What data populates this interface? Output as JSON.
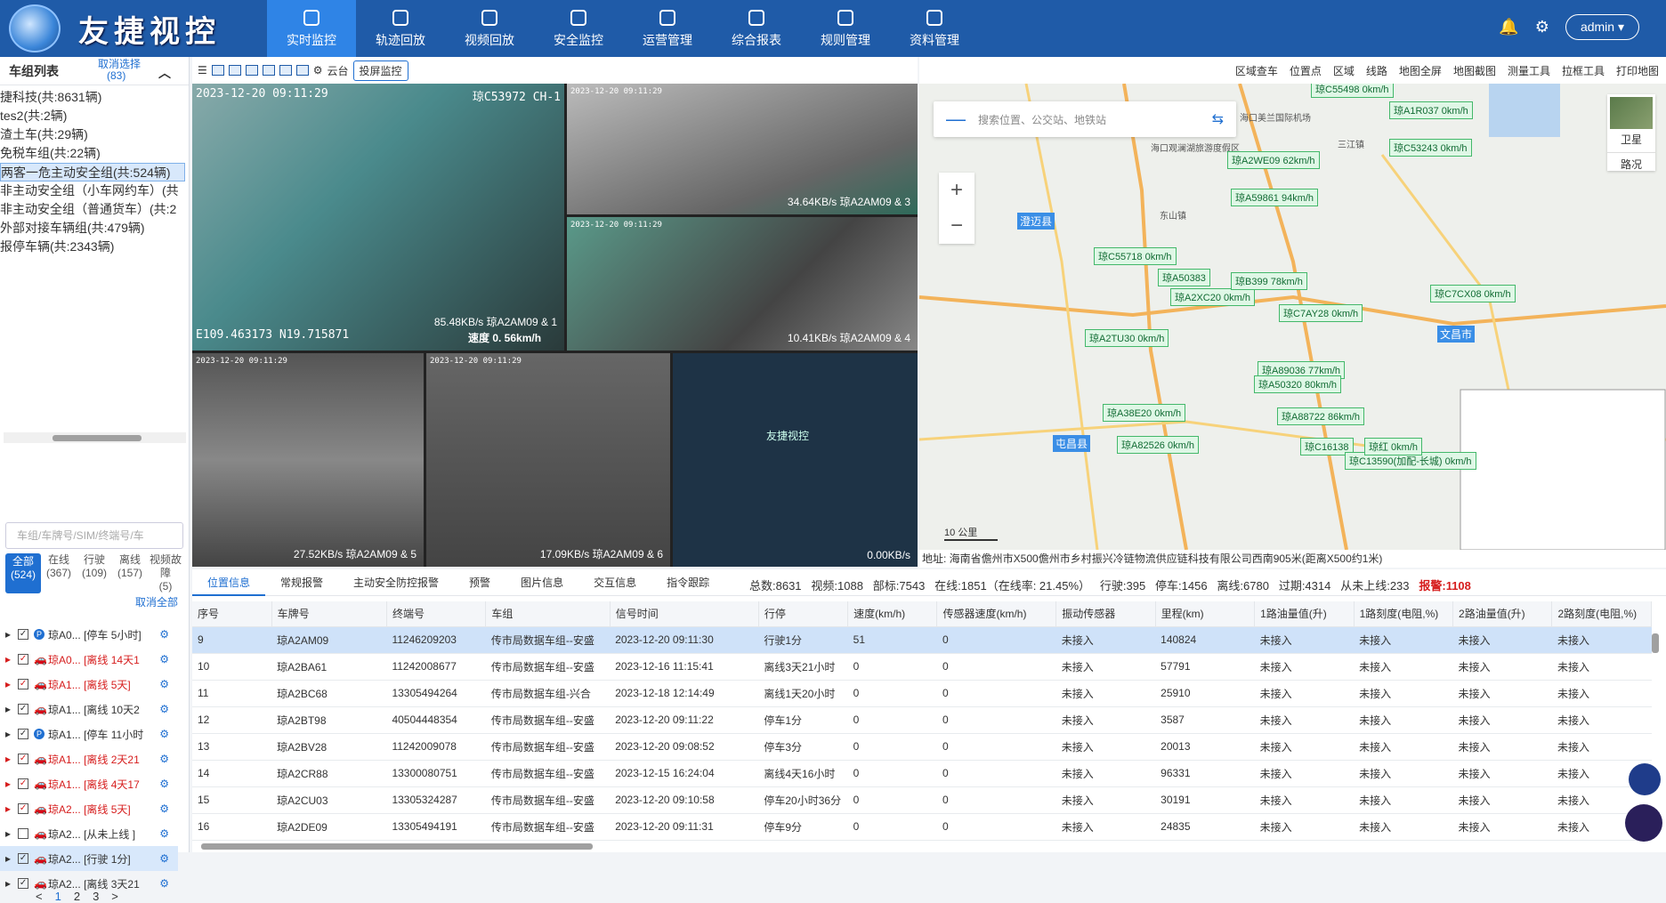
{
  "brand": {
    "name": "友捷视控",
    "video_watermark": "友捷视控"
  },
  "nav": [
    {
      "label": "实时监控",
      "icon": "monitor-icon",
      "active": true
    },
    {
      "label": "轨迹回放",
      "icon": "track-icon"
    },
    {
      "label": "视频回放",
      "icon": "play-icon"
    },
    {
      "label": "安全监控",
      "icon": "shield-icon"
    },
    {
      "label": "运营管理",
      "icon": "ops-icon"
    },
    {
      "label": "综合报表",
      "icon": "report-icon"
    },
    {
      "label": "规则管理",
      "icon": "rules-icon"
    },
    {
      "label": "资料管理",
      "icon": "data-icon"
    }
  ],
  "user": {
    "name": "admin ▾"
  },
  "left": {
    "title": "车组列表",
    "cancel_select": "取消选择",
    "cancel_count": "(83)",
    "groups": [
      "捷科技(共:8631辆)",
      "tes2(共:2辆)",
      "渣土车(共:29辆)",
      "免税车组(共:22辆)",
      "两客一危主动安全组(共:524辆)",
      "非主动安全组（小车网约车）(共",
      "非主动安全组（普通货车）(共:2",
      "外部对接车辆组(共:479辆)",
      "报停车辆(共:2343辆)"
    ],
    "search_placeholder": "车组/车牌号/SIM/终端号/车",
    "filters": [
      {
        "label": "全部",
        "count": "(524)"
      },
      {
        "label": "在线",
        "count": "(367)"
      },
      {
        "label": "行驶",
        "count": "(109)"
      },
      {
        "label": "离线",
        "count": "(157)"
      },
      {
        "label": "视频故障",
        "count": "(5)"
      }
    ],
    "cancel_all": "取消全部",
    "vehicles": [
      {
        "plate": "琼A0...",
        "status": "[停车 5小时]",
        "red": false,
        "p": true
      },
      {
        "plate": "琼A0...",
        "status": "[离线 14天1",
        "red": true,
        "p": false
      },
      {
        "plate": "琼A1...",
        "status": "[离线 5天]",
        "red": true,
        "p": false
      },
      {
        "plate": "琼A1...",
        "status": "[离线 10天2",
        "red": false,
        "p": false
      },
      {
        "plate": "琼A1...",
        "status": "[停车 11小时",
        "red": false,
        "p": true
      },
      {
        "plate": "琼A1...",
        "status": "[离线 2天21",
        "red": true,
        "p": false
      },
      {
        "plate": "琼A1...",
        "status": "[离线 4天17",
        "red": true,
        "p": false
      },
      {
        "plate": "琼A2...",
        "status": "[离线 5天]",
        "red": true,
        "p": false
      },
      {
        "plate": "琼A2...",
        "status": "[从未上线 ]",
        "red": false,
        "p": false
      },
      {
        "plate": "琼A2...",
        "status": "[行驶 1分]",
        "red": false,
        "p": false,
        "hl": true
      },
      {
        "plate": "琼A2...",
        "status": "[离线 3天21",
        "red": false,
        "p": false
      }
    ],
    "pages": [
      "<",
      "1",
      "2",
      "3",
      ">"
    ]
  },
  "videotool": {
    "ptz": "云台",
    "cast": "投屏监控"
  },
  "videos": [
    {
      "ts": "2023-12-20 09:11:29",
      "ch": "琼C53972 CH-1",
      "speed": "85.48KB/s 琼A2AM09 & 1",
      "coord": "E109.463173 N19.715871",
      "spd2": "速度 0. 56km/h"
    },
    {
      "ts": "2023-12-20 09:11:29",
      "speed": "34.64KB/s 琼A2AM09 & 3"
    },
    {
      "ts": "2023-12-20 09:11:29",
      "speed": "10.41KB/s 琼A2AM09 & 4"
    },
    {
      "ts": "2023-12-20 09:11:29",
      "speed": "27.52KB/s 琼A2AM09 & 5"
    },
    {
      "ts": "2023-12-20 09:11:29",
      "speed": "17.09KB/s 琼A2AM09 & 6"
    },
    {
      "ts": "",
      "speed": "0.00KB/s"
    }
  ],
  "maptool": [
    "区域查车",
    "位置点",
    "区域",
    "线路",
    "地图全屏",
    "地图截图",
    "测量工具",
    "拉框工具",
    "打印地图"
  ],
  "map": {
    "search_placeholder": "搜索位置、公交站、地铁站",
    "sat": "卫星",
    "road": "路况",
    "scale": "10 公里",
    "places": [
      "海口美兰国际机场",
      "澄迈县",
      "屯昌县",
      "文昌市",
      "三江镇",
      "东山镇",
      "海口观澜湖旅游度假区"
    ],
    "labels": [
      "琼C55498 0km/h",
      "琼A1R037 0km/h",
      "琼C53243 0km/h",
      "琼A2WE09 62km/h",
      "琼A59861 94km/h",
      "琼C55718 0km/h",
      "琼A50383",
      "琼A2XC20 0km/h",
      "琼B399 78km/h",
      "琼C7AY28 0km/h",
      "琼C7CX08 0km/h",
      "琼A2TU30 0km/h",
      "琼A89036 77km/h",
      "琼A50320 80km/h",
      "琼A38E20 0km/h",
      "琼A88722 86km/h",
      "琼A82526 0km/h",
      "琼C16138",
      "琼C13590(加配-长城) 0km/h",
      "琼红 0km/h"
    ]
  },
  "address": "地址: 海南省儋州市X500儋州市乡村振兴冷链物流供应链科技有限公司西南905米(距离X500约1米)",
  "bottom": {
    "tabs": [
      "位置信息",
      "常规报警",
      "主动安全防控报警",
      "预警",
      "图片信息",
      "交互信息",
      "指令跟踪"
    ],
    "stats": {
      "total": "总数:8631",
      "video": "视频:1088",
      "bd": "部标:7543",
      "online": "在线:1851（在线率:  21.45%）",
      "driving": "行驶:395",
      "parked": "停车:1456",
      "offline": "离线:6780",
      "expired": "过期:4314",
      "never": "从未上线:233",
      "alarm": "报警:1108"
    },
    "columns": [
      "序号",
      "车牌号",
      "终端号",
      "车组",
      "信号时间",
      "行停",
      "速度(km/h)",
      "传感器速度(km/h)",
      "振动传感器",
      "里程(km)",
      "1路油量值(升)",
      "1路刻度(电阻,%)",
      "2路油量值(升)",
      "2路刻度(电阻,%)"
    ],
    "rows": [
      [
        "9",
        "琼A2AM09",
        "11246209203",
        "传市局数据车组--安盛",
        "2023-12-20 09:11:30",
        "行驶1分",
        "51",
        "0",
        "未接入",
        "140824",
        "未接入",
        "未接入",
        "未接入",
        "未接入"
      ],
      [
        "10",
        "琼A2BA61",
        "11242008677",
        "传市局数据车组--安盛",
        "2023-12-16 11:15:41",
        "离线3天21小时",
        "0",
        "0",
        "未接入",
        "57791",
        "未接入",
        "未接入",
        "未接入",
        "未接入"
      ],
      [
        "11",
        "琼A2BC68",
        "13305494264",
        "传市局数据车组-兴合",
        "2023-12-18 12:14:49",
        "离线1天20小时",
        "0",
        "0",
        "未接入",
        "25910",
        "未接入",
        "未接入",
        "未接入",
        "未接入"
      ],
      [
        "12",
        "琼A2BT98",
        "40504448354",
        "传市局数据车组--安盛",
        "2023-12-20 09:11:22",
        "停车1分",
        "0",
        "0",
        "未接入",
        "3587",
        "未接入",
        "未接入",
        "未接入",
        "未接入"
      ],
      [
        "13",
        "琼A2BV28",
        "11242009078",
        "传市局数据车组--安盛",
        "2023-12-20 09:08:52",
        "停车3分",
        "0",
        "0",
        "未接入",
        "20013",
        "未接入",
        "未接入",
        "未接入",
        "未接入"
      ],
      [
        "14",
        "琼A2CR88",
        "13300080751",
        "传市局数据车组--安盛",
        "2023-12-15 16:24:04",
        "离线4天16小时",
        "0",
        "0",
        "未接入",
        "96331",
        "未接入",
        "未接入",
        "未接入",
        "未接入"
      ],
      [
        "15",
        "琼A2CU03",
        "13305324287",
        "传市局数据车组--安盛",
        "2023-12-20 09:10:58",
        "停车20小时36分",
        "0",
        "0",
        "未接入",
        "30191",
        "未接入",
        "未接入",
        "未接入",
        "未接入"
      ],
      [
        "16",
        "琼A2DE09",
        "13305494191",
        "传市局数据车组--安盛",
        "2023-12-20 09:11:31",
        "停车9分",
        "0",
        "0",
        "未接入",
        "24835",
        "未接入",
        "未接入",
        "未接入",
        "未接入"
      ]
    ]
  }
}
